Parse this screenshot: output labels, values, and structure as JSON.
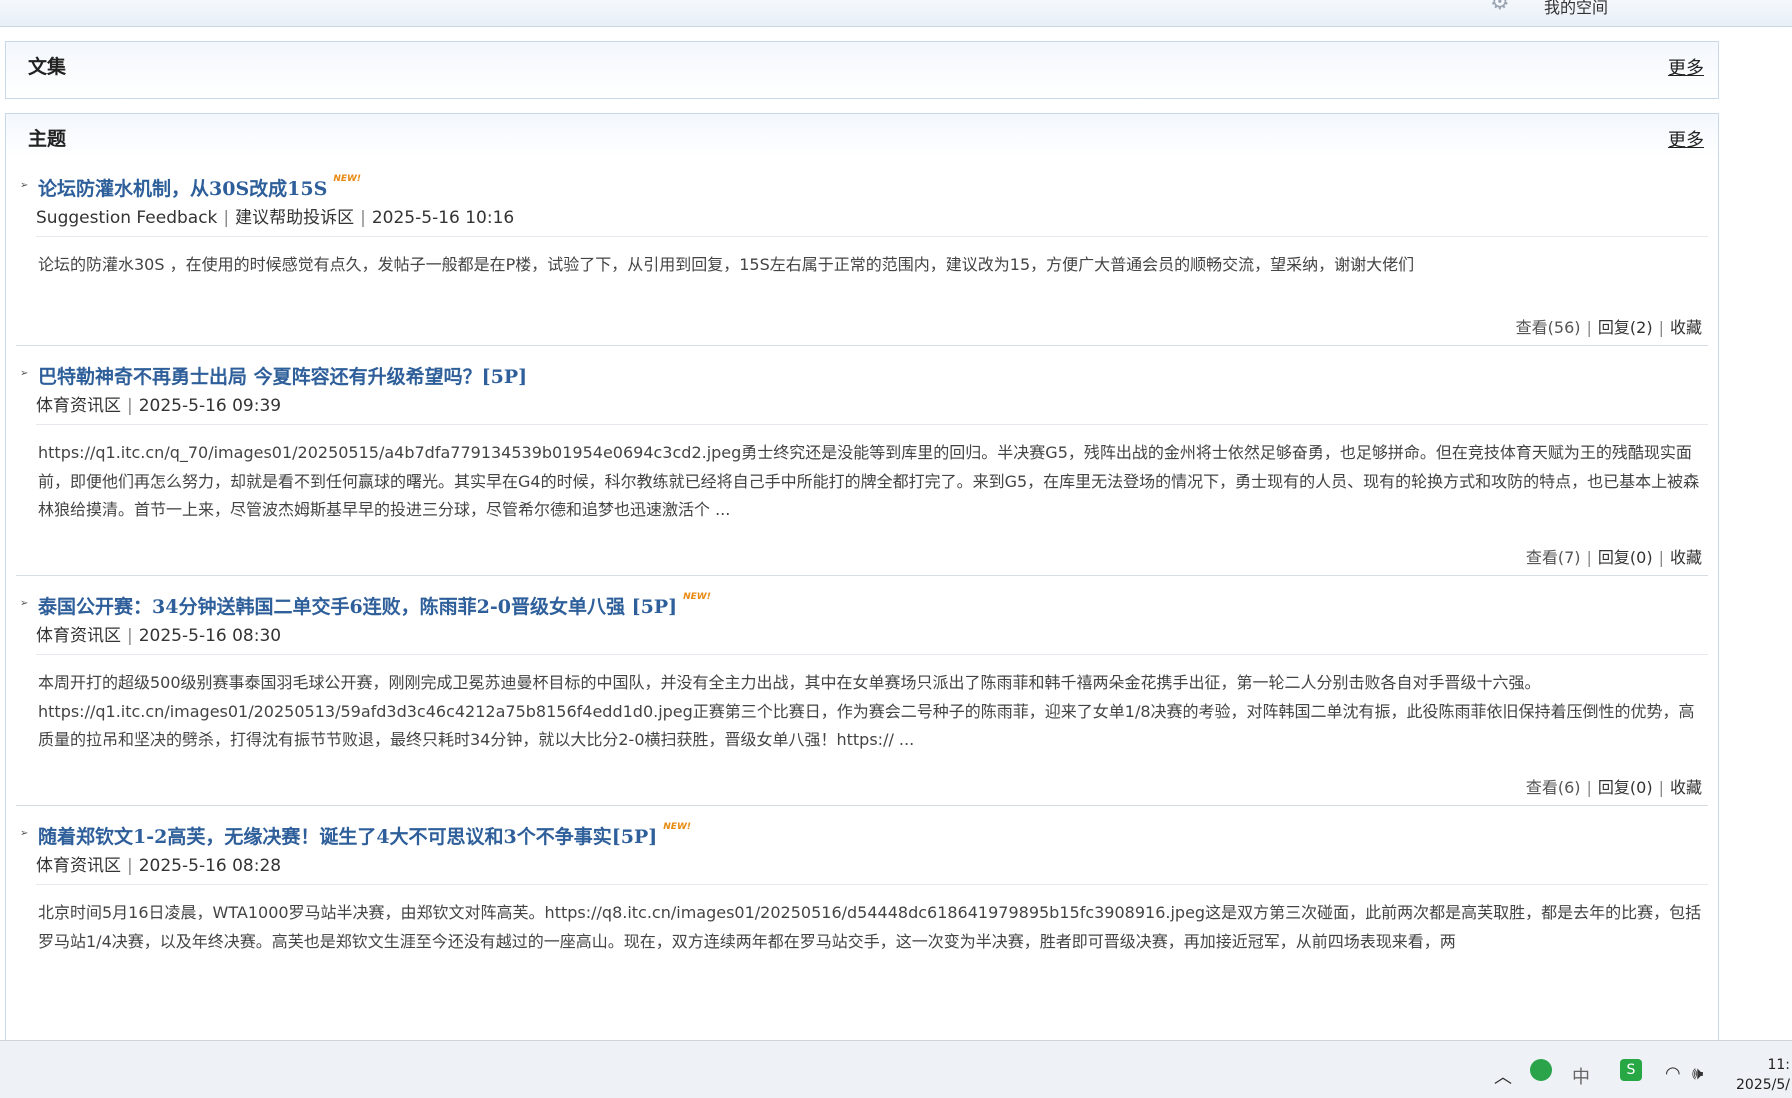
{
  "topbar": {
    "gear_icon": "gear-icon",
    "my_space": "我的空间"
  },
  "collection": {
    "title": "文集",
    "more": "更多"
  },
  "topics": {
    "title": "主题",
    "more": "更多",
    "posts": [
      {
        "title": "论坛防灌水机制，从30S改成15S",
        "is_new": true,
        "meta": [
          "Suggestion Feedback",
          "建议帮助投诉区",
          "2025-5-16 10:16"
        ],
        "body": "论坛的防灌水30S ，在使用的时候感觉有点久，发帖子一般都是在P楼，试验了下，从引用到回复，15S左右属于正常的范围内，建议改为15，方便广大普通会员的顺畅交流，望采纳，谢谢大佬们",
        "views": "查看(56)",
        "replies": "回复(2)",
        "favorite": "收藏"
      },
      {
        "title": "巴特勒神奇不再勇士出局 今夏阵容还有升级希望吗？[5P]",
        "is_new": false,
        "meta": [
          "体育资讯区",
          "2025-5-16 09:39"
        ],
        "body": "https://q1.itc.cn/q_70/images01/20250515/a4b7dfa779134539b01954e0694c3cd2.jpeg勇士终究还是没能等到库里的回归。半决赛G5，残阵出战的金州将士依然足够奋勇，也足够拼命。但在竞技体育天赋为王的残酷现实面前，即便他们再怎么努力，却就是看不到任何赢球的曙光。其实早在G4的时候，科尔教练就已经将自己手中所能打的牌全都打完了。来到G5，在库里无法登场的情况下，勇士现有的人员、现有的轮换方式和攻防的特点，也已基本上被森林狼给摸清。首节一上来，尽管波杰姆斯基早早的投进三分球，尽管希尔德和追梦也迅速激活个 ...",
        "views": "查看(7)",
        "replies": "回复(0)",
        "favorite": "收藏"
      },
      {
        "title": "泰国公开赛：34分钟送韩国二单交手6连败，陈雨菲2-0晋级女单八强 [5P]",
        "is_new": true,
        "meta": [
          "体育资讯区",
          "2025-5-16 08:30"
        ],
        "body": "本周开打的超级500级别赛事泰国羽毛球公开赛，刚刚完成卫冕苏迪曼杯目标的中国队，并没有全主力出战，其中在女单赛场只派出了陈雨菲和韩千禧两朵金花携手出征，第一轮二人分别击败各自对手晋级十六强。https://q1.itc.cn/images01/20250513/59afd3d3c46c4212a75b8156f4edd1d0.jpeg正赛第三个比赛日，作为赛会二号种子的陈雨菲，迎来了女单1/8决赛的考验，对阵韩国二单沈有振，此役陈雨菲依旧保持着压倒性的优势，高质量的拉吊和坚决的劈杀，打得沈有振节节败退，最终只耗时34分钟，就以大比分2-0横扫获胜，晋级女单八强！https:// ...",
        "views": "查看(6)",
        "replies": "回复(0)",
        "favorite": "收藏"
      },
      {
        "title": "随着郑钦文1-2高芙，无缘决赛！诞生了4大不可思议和3个不争事实[5P]",
        "is_new": true,
        "meta": [
          "体育资讯区",
          "2025-5-16 08:28"
        ],
        "body": "北京时间5月16日凌晨，WTA1000罗马站半决赛，由郑钦文对阵高芙。https://q8.itc.cn/images01/20250516/d54448dc618641979895b15fc3908916.jpeg这是双方第三次碰面，此前两次都是高芙取胜，都是去年的比赛，包括罗马站1/4决赛，以及年终决赛。高芙也是郑钦文生涯至今还没有越过的一座高山。现在，双方连续两年都在罗马站交手，这一次变为半决赛，胜者即可晋级决赛，再加接近冠军，从前四场表现来看，两",
        "views": "",
        "replies": "",
        "favorite": ""
      }
    ]
  },
  "taskbar": {
    "chevron_icon": "chevron-up-icon",
    "ime_label": "中",
    "wifi_icon": "wifi-icon",
    "volume_icon": "volume-icon",
    "time": "11:",
    "date": "2025/5/"
  }
}
